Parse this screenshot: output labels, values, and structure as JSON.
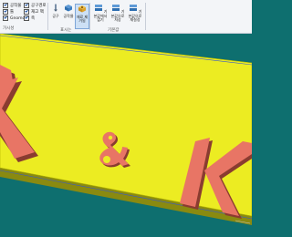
{
  "ribbon": {
    "checkboxes": [
      {
        "label": "공작물",
        "checked": true
      },
      {
        "label": "공구경로",
        "checked": true
      },
      {
        "label": "툴",
        "checked": true
      },
      {
        "label": "재고 팩",
        "checked": true
      },
      {
        "label": "Gnomon",
        "checked": true
      },
      {
        "label": "축",
        "checked": true
      }
    ],
    "visibility_group_label": "가시성",
    "buttons": [
      {
        "label": "공구",
        "icon": "tool-icon"
      },
      {
        "label": "공작물",
        "icon": "workpiece-icon"
      },
      {
        "label": "재료 제거됨",
        "icon": "material-removed-icon",
        "selected": true
      },
      {
        "label": "기본값에서 없기",
        "icon": "default-view-icon"
      },
      {
        "label": "기본값으로 저장",
        "icon": "save-default-icon"
      },
      {
        "label": "기본값으로 재설정",
        "icon": "reset-default-icon"
      }
    ],
    "appearance_group_label": "표시는",
    "defaults_group_label": "기본값"
  },
  "scene": {
    "text": "K & K",
    "plate_color": "#ecec22",
    "letter_color": "#e87565",
    "background_color": "#0e6f6f"
  }
}
